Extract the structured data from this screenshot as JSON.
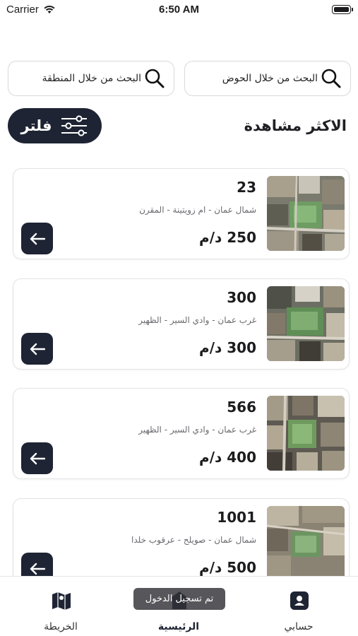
{
  "status_bar": {
    "carrier": "Carrier",
    "time": "6:50 AM"
  },
  "search": {
    "basin_label": "البحث من خلال الحوض",
    "area_label": "البحث من خلال المنطقة"
  },
  "section_title": "الاكثر مشاهدة",
  "filter_label": "فلتر",
  "listings": [
    {
      "plot_number": "23",
      "location": "شمال عمان - ام زويتينة - المقرن",
      "price": "250 د/م"
    },
    {
      "plot_number": "300",
      "location": "غرب عمان - وادي السير - الظهير",
      "price": "300 د/م"
    },
    {
      "plot_number": "566",
      "location": "غرب عمان - وادي السير - الظهير",
      "price": "400 د/م"
    },
    {
      "plot_number": "1001",
      "location": "شمال عمان - صويلح - عرقوب خلدا",
      "price": "500 د/م"
    }
  ],
  "tabs": {
    "account": "حسابي",
    "home": "الرئيسية",
    "map": "الخريطة"
  },
  "toast": "تم تسجيل الدخول",
  "colors": {
    "primary_dark": "#1e2433"
  }
}
